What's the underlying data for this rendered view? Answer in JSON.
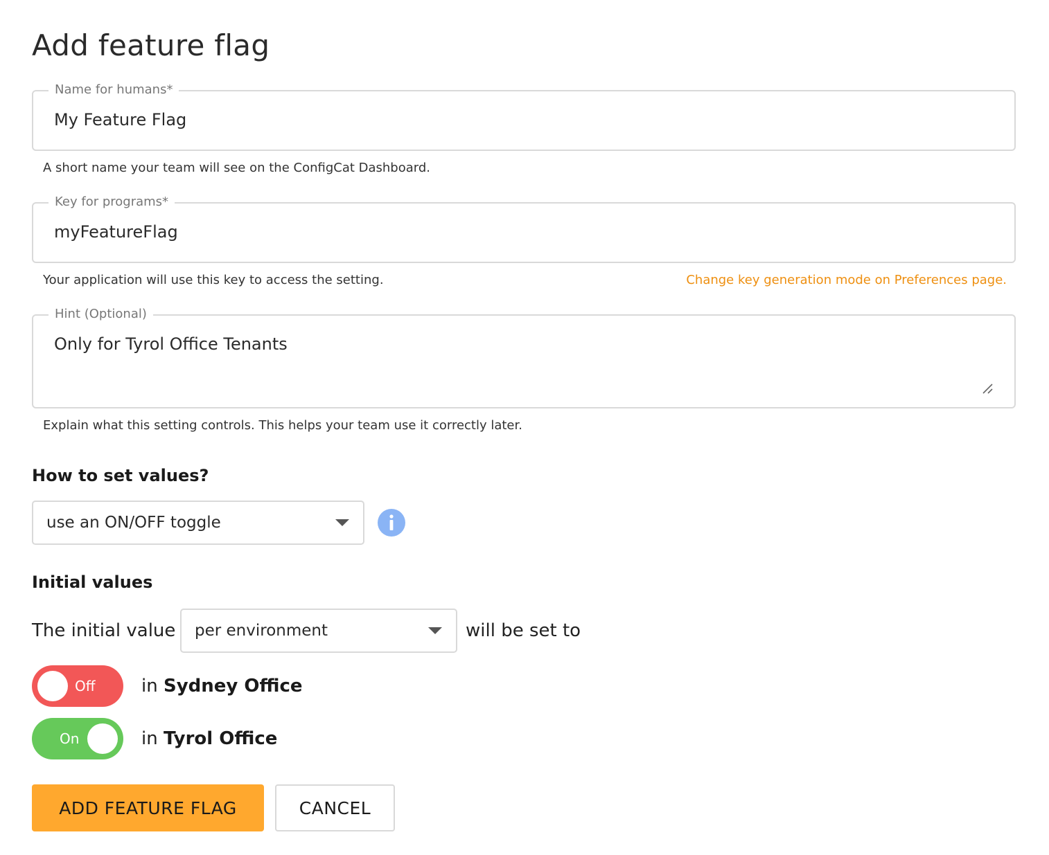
{
  "page": {
    "title": "Add feature flag"
  },
  "form": {
    "name": {
      "label": "Name for humans*",
      "value": "My Feature Flag",
      "helper": "A short name your team will see on the ConfigCat Dashboard."
    },
    "key": {
      "label": "Key for programs*",
      "value": "myFeatureFlag",
      "helper": "Your application will use this key to access the setting.",
      "link": "Change key generation mode on Preferences page."
    },
    "hint": {
      "label": "Hint (Optional)",
      "value": "Only for Tyrol Office Tenants",
      "helper": "Explain what this setting controls. This helps your team use it correctly later."
    }
  },
  "value_type": {
    "heading": "How to set values?",
    "selected": "use an ON/OFF toggle",
    "info_icon": "info-icon"
  },
  "initial_values": {
    "heading": "Initial values",
    "prefix": "The initial value",
    "mode_selected": "per environment",
    "suffix": "will be set to",
    "environments": [
      {
        "prefix": "in",
        "name": "Sydney Office",
        "state_label": "Off",
        "enabled": false
      },
      {
        "prefix": "in",
        "name": "Tyrol Office",
        "state_label": "On",
        "enabled": true
      }
    ]
  },
  "actions": {
    "submit_label": "ADD FEATURE FLAG",
    "cancel_label": "CANCEL"
  },
  "colors": {
    "accent": "#ffa82e",
    "link": "#ee8f10",
    "toggle_off": "#f25757",
    "toggle_on": "#66c95a",
    "info": "#8ab4f5"
  }
}
